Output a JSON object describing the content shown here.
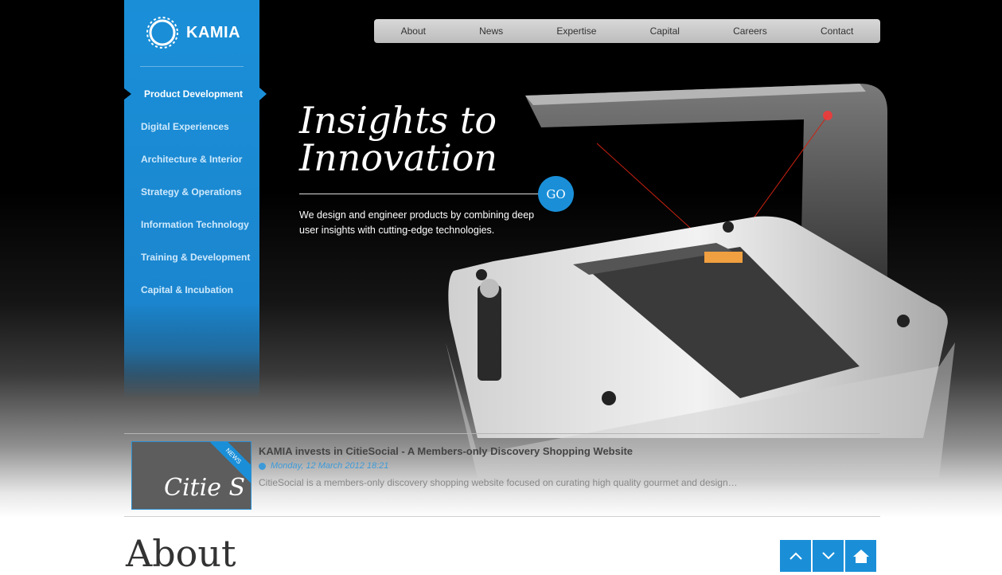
{
  "brand": {
    "name": "KAMIA"
  },
  "sidebar": {
    "items": [
      {
        "label": "Product Development",
        "active": true
      },
      {
        "label": "Digital Experiences"
      },
      {
        "label": "Architecture & Interior"
      },
      {
        "label": "Strategy & Operations"
      },
      {
        "label": "Information Technology"
      },
      {
        "label": "Training & Development"
      },
      {
        "label": "Capital & Incubation"
      }
    ]
  },
  "topnav": {
    "items": [
      "About",
      "News",
      "Expertise",
      "Capital",
      "Careers",
      "Contact"
    ]
  },
  "hero": {
    "headline_line1": "Insights to",
    "headline_line2": "Innovation",
    "go_label": "GO",
    "tagline": "We design and engineer products by combining deep user insights with cutting-edge technologies."
  },
  "news": {
    "ribbon": "NEWS",
    "thumb_text": "Citie S",
    "title": "KAMIA invests in CitieSocial - A Members-only Discovery Shopping Website",
    "date": "Monday, 12 March 2012 18:21",
    "excerpt": "CitieSocial is a members-only discovery shopping website focused on curating high quality gourmet and design…"
  },
  "section": {
    "heading": "About"
  },
  "colors": {
    "accent": "#1a8fd8",
    "background": "#000000"
  },
  "icons": [
    "logo-ring-icon",
    "chevron-up-icon",
    "chevron-down-icon",
    "home-icon"
  ]
}
